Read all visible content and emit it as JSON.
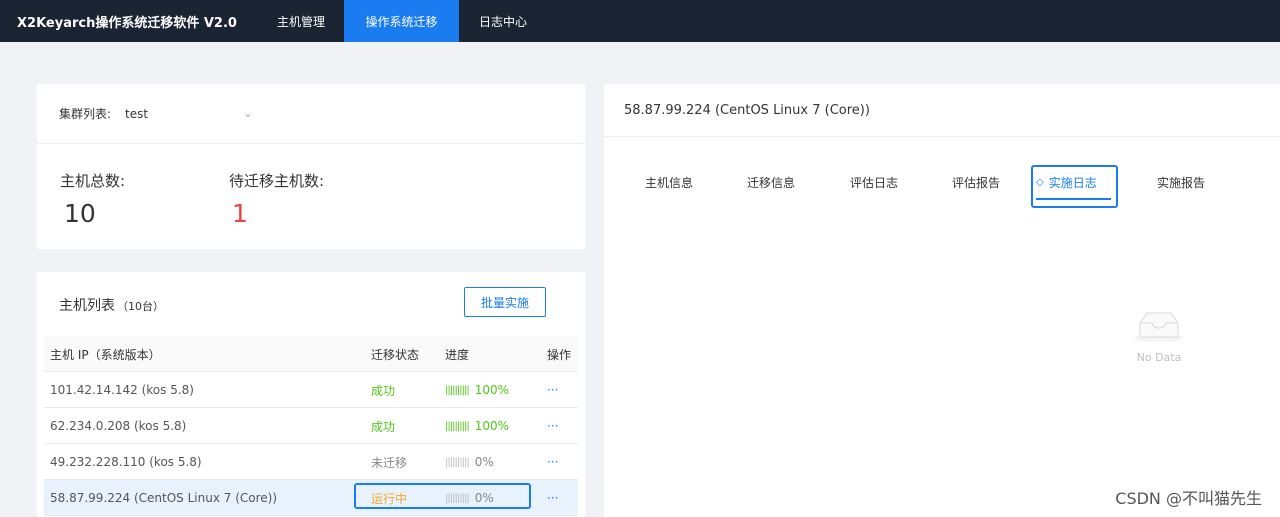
{
  "header": {
    "app_title": "X2Keyarch操作系统迁移软件 V2.0",
    "nav": [
      "主机管理",
      "操作系统迁移",
      "日志中心"
    ]
  },
  "cluster": {
    "label": "集群列表:",
    "selected": "test",
    "total_label": "主机总数:",
    "total_value": "10",
    "pending_label": "待迁移主机数:",
    "pending_value": "1"
  },
  "hosts": {
    "title": "主机列表",
    "count": "（10台）",
    "batch_button": "批量实施",
    "columns": [
      "主机 IP（系统版本）",
      "迁移状态",
      "进度",
      "操作"
    ],
    "rows": [
      {
        "ip": "101.42.14.142 (kos 5.8)",
        "status": "成功",
        "progress": "100%",
        "progress_value": 100,
        "op": "···"
      },
      {
        "ip": "62.234.0.208 (kos 5.8)",
        "status": "成功",
        "progress": "100%",
        "progress_value": 100,
        "op": "···"
      },
      {
        "ip": "49.232.228.110 (kos 5.8)",
        "status": "未迁移",
        "progress": "0%",
        "progress_value": 0,
        "op": "···"
      },
      {
        "ip": "58.87.99.224 (CentOS Linux 7 (Core))",
        "status": "运行中",
        "progress": "0%",
        "progress_value": 0,
        "op": "···"
      }
    ]
  },
  "detail": {
    "host_title": "58.87.99.224 (CentOS Linux 7 (Core))",
    "tabs": [
      "主机信息",
      "迁移信息",
      "评估日志",
      "评估报告",
      "实施日志",
      "实施报告"
    ],
    "active_tab": "实施日志",
    "empty_text": "No Data"
  },
  "watermark": "CSDN @不叫猫先生",
  "colors": {
    "topbar": "#1b2433",
    "accent": "#1a7cf0",
    "success": "#52c41a",
    "running": "#f5a623",
    "pending": "#e64545"
  }
}
